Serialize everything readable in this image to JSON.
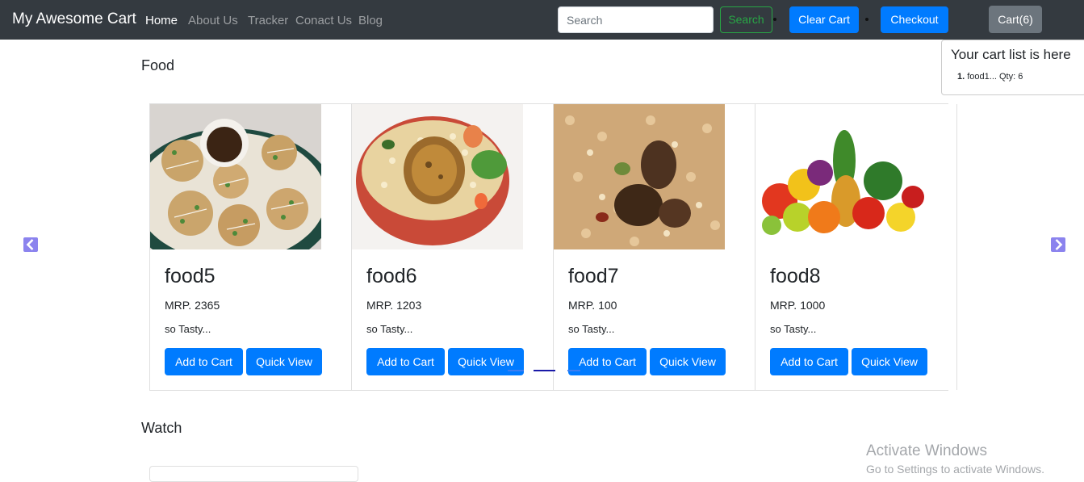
{
  "navbar": {
    "brand": "My Awesome Cart",
    "links": [
      "Home",
      "About Us",
      "Tracker",
      "Conact Us",
      "Blog"
    ],
    "search_placeholder": "Search",
    "search_button": "Search",
    "clear_cart": "Clear Cart",
    "checkout": "Checkout",
    "cart_button": "Cart(6)"
  },
  "popover": {
    "title": "Your cart list is here",
    "items": [
      {
        "index": "1.",
        "text": "food1... Qty: 6"
      }
    ]
  },
  "sections": [
    {
      "title": "Food"
    },
    {
      "title": "Watch"
    }
  ],
  "products": [
    {
      "name": "food5",
      "price": "MRP. 2365",
      "desc": "so Tasty...",
      "add": "Add to Cart",
      "quick": "Quick View",
      "image": "fried-snack-plate"
    },
    {
      "name": "food6",
      "price": "MRP. 1203",
      "desc": "so Tasty...",
      "add": "Add to Cart",
      "quick": "Quick View",
      "image": "fish-rice-bowl"
    },
    {
      "name": "food7",
      "price": "MRP. 100",
      "desc": "so Tasty...",
      "add": "Add to Cart",
      "quick": "Quick View",
      "image": "biryani"
    },
    {
      "name": "food8",
      "price": "MRP. 1000",
      "desc": "so Tasty...",
      "add": "Add to Cart",
      "quick": "Quick View",
      "image": "fruits-vegetables"
    }
  ],
  "icons": {
    "carousel_prev": "chevron-left-icon",
    "carousel_next": "chevron-right-icon"
  },
  "watermark": {
    "title": "Activate Windows",
    "subtitle": "Go to Settings to activate Windows."
  },
  "colors": {
    "navbar": "#343a40",
    "primary": "#007bff",
    "success": "#28a745",
    "secondary": "#6c757d",
    "carousel_control": "#8b83ee"
  }
}
